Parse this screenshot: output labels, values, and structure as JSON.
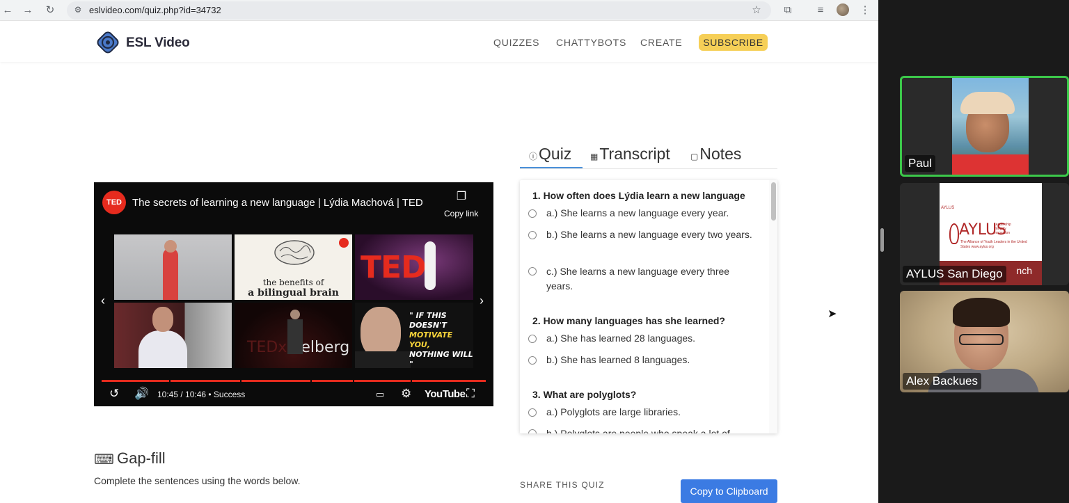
{
  "browser": {
    "url": "eslvideo.com/quiz.php?id=34732",
    "icons": [
      "back-arrow-icon",
      "forward-arrow-icon",
      "reload-icon",
      "site-info-icon",
      "bookmark-star-icon",
      "extensions-icon",
      "media-control-icon",
      "profile-avatar-icon",
      "menu-kebab-icon"
    ]
  },
  "header": {
    "brand": "ESL Video",
    "nav": [
      "QUIZZES",
      "CHATTYBOTS",
      "CREATE"
    ],
    "subscribe": "SUBSCRIBE",
    "colors": {
      "subscribe_bg": "#f6cf57",
      "brand_accent": "#4a79c9"
    }
  },
  "video": {
    "channel_badge": "TED",
    "title": "The secrets of learning a new language | Lýdia Machová | TED",
    "copy_link": "Copy link",
    "time": "10:45 / 10:46 • Success",
    "youtube_label": "YouTube",
    "thumb_brain_line1": "the benefits of",
    "thumb_brain_line2": "a bilingual brain",
    "thumb_ted": "TED",
    "thumb_tedx_pre": "TEDx",
    "thumb_tedx_post": "idelberg",
    "thumb_quote_line1": "\" IF THIS DOESN'T",
    "thumb_quote_line2": "MOTIVATE YOU,",
    "thumb_quote_line3": "NOTHING WILL \"",
    "progress": 0.998,
    "colors": {
      "progress": "#e62b1e"
    }
  },
  "tabs": [
    {
      "label": "Quiz",
      "icon": "help-circle-icon",
      "active": true
    },
    {
      "label": "Transcript",
      "icon": "book-icon",
      "active": false
    },
    {
      "label": "Notes",
      "icon": "note-icon",
      "active": false
    }
  ],
  "quiz": {
    "questions": [
      {
        "title": "1. How often does Lýdia learn a new language",
        "options": [
          "a.) She learns a new language every year.",
          "b.) She learns a new language every two years.",
          "c.) She learns a new language every three years."
        ]
      },
      {
        "title": "2. How many languages has she learned?",
        "options": [
          "a.) She has learned 28 languages.",
          "b.) She has learned 8 languages."
        ]
      },
      {
        "title": "3. What are polyglots?",
        "options": [
          "a.) Polyglots are large libraries.",
          "b.) Polyglots are people who speak a lot of"
        ]
      }
    ]
  },
  "gapfill": {
    "title": "Gap-fill",
    "subtitle": "Complete the sentences using the words below."
  },
  "share": {
    "label": "SHARE THIS QUIZ",
    "button": "Copy to Clipboard"
  },
  "call": {
    "participants": [
      {
        "name": "Paul",
        "active": true
      },
      {
        "name": "AYLUS San Diego",
        "active": false
      },
      {
        "name": "Alex Backues",
        "active": false
      }
    ],
    "aylus_slide": {
      "small": "AYLUS",
      "logo": "AYLUS",
      "tag": "Leadership Integrity Innovation",
      "sub": "The Alliance of Youth Leaders in the United States www.aylus.org",
      "bar_text": "nch"
    },
    "colors": {
      "active_border": "#3cc84a"
    }
  }
}
